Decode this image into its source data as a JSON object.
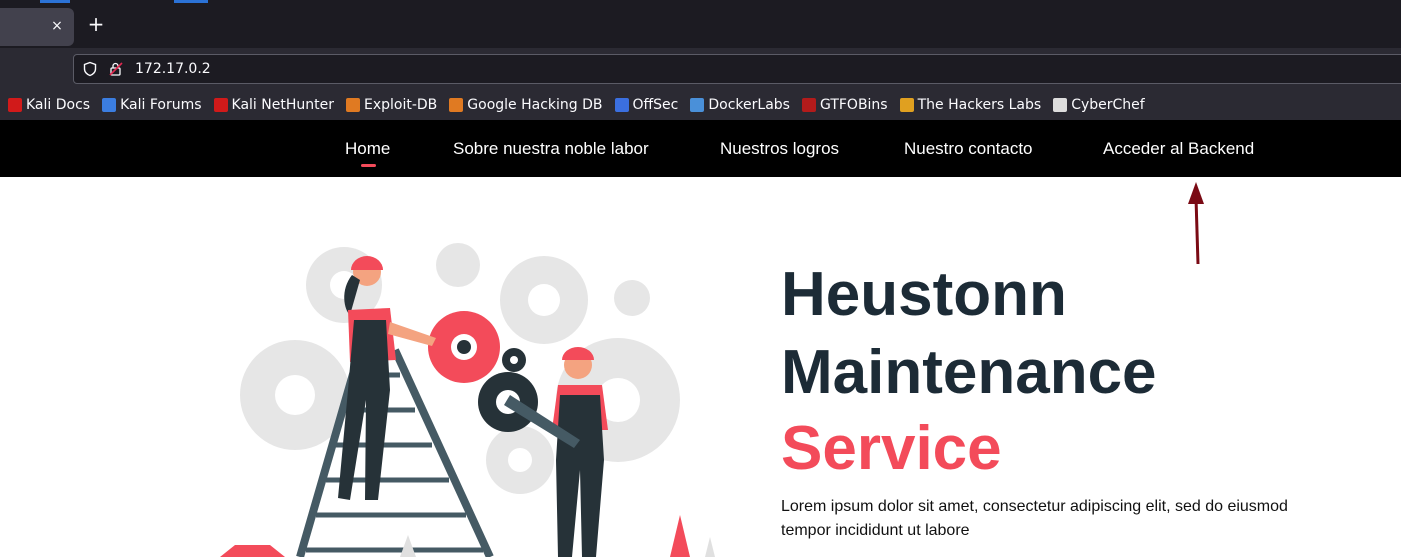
{
  "browser": {
    "tab_close": "×",
    "new_tab": "+",
    "url": "172.17.0.2",
    "bookmarks": [
      {
        "label": "Kali Docs",
        "icon": "kali-docs-icon",
        "color": "#d11a1a"
      },
      {
        "label": "Kali Forums",
        "icon": "kali-forums-icon",
        "color": "#3b7de0"
      },
      {
        "label": "Kali NetHunter",
        "icon": "kali-nethunter-icon",
        "color": "#d11a1a"
      },
      {
        "label": "Exploit-DB",
        "icon": "exploit-db-icon",
        "color": "#e07a22"
      },
      {
        "label": "Google Hacking DB",
        "icon": "ghdb-icon",
        "color": "#e07a22"
      },
      {
        "label": "OffSec",
        "icon": "offsec-icon",
        "color": "#3b6fe0"
      },
      {
        "label": "DockerLabs",
        "icon": "dockerlabs-icon",
        "color": "#4a90d9"
      },
      {
        "label": "GTFOBins",
        "icon": "gtfobins-icon",
        "color": "#b31b1b"
      },
      {
        "label": "The Hackers Labs",
        "icon": "hackers-labs-icon",
        "color": "#e0a020"
      },
      {
        "label": "CyberChef",
        "icon": "cyberchef-icon",
        "color": "#dddddd"
      }
    ]
  },
  "nav": {
    "items": [
      {
        "label": "Home",
        "active": true
      },
      {
        "label": "Sobre nuestra noble labor",
        "active": false
      },
      {
        "label": "Nuestros logros",
        "active": false
      },
      {
        "label": "Nuestro contacto",
        "active": false
      },
      {
        "label": "Acceder al Backend",
        "active": false
      }
    ]
  },
  "hero": {
    "title_line1": "Heustonn",
    "title_line2": "Maintenance",
    "title_line3": "Service",
    "description": "Lorem ipsum dolor sit amet, consectetur adipiscing elit, sed do eiusmod tempor incididunt ut labore"
  },
  "colors": {
    "accent": "#f34b5a",
    "heading": "#1c2b36",
    "nav_bg": "#000000",
    "annotation_arrow": "#7a0a14"
  }
}
